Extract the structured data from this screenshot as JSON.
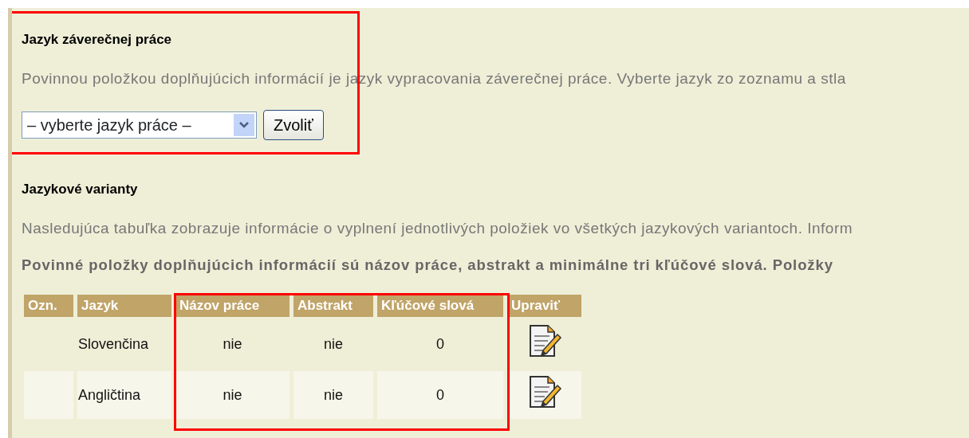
{
  "language_section": {
    "heading": "Jazyk záverečnej práce",
    "text": "Povinnou položkou doplňujúcich informácií je jazyk vypracovania záverečnej práce. Vyberte jazyk zo zoznamu a stla",
    "select": {
      "value": "– vyberte jazyk práce –"
    },
    "button": "Zvoliť"
  },
  "variants_section": {
    "heading": "Jazykové varianty",
    "text": "Nasledujúca tabuľka zobrazuje informácie o vyplnení jednotlivých položiek vo všetkých jazykových variantoch. Inform",
    "bold_text": "Povinné položky doplňujúcich informácií sú názov práce, abstrakt a minimálne tri kľúčové slová. Položky"
  },
  "table": {
    "columns": [
      "Ozn.",
      "Jazyk",
      "Názov práce",
      "Abstrakt",
      "Kľúčové slová",
      "Upraviť"
    ],
    "rows": [
      {
        "mark": "",
        "language": "Slovenčina",
        "title": "nie",
        "abstract": "nie",
        "keywords": "0"
      },
      {
        "mark": "",
        "language": "Angličtina",
        "title": "nie",
        "abstract": "nie",
        "keywords": "0"
      }
    ]
  }
}
